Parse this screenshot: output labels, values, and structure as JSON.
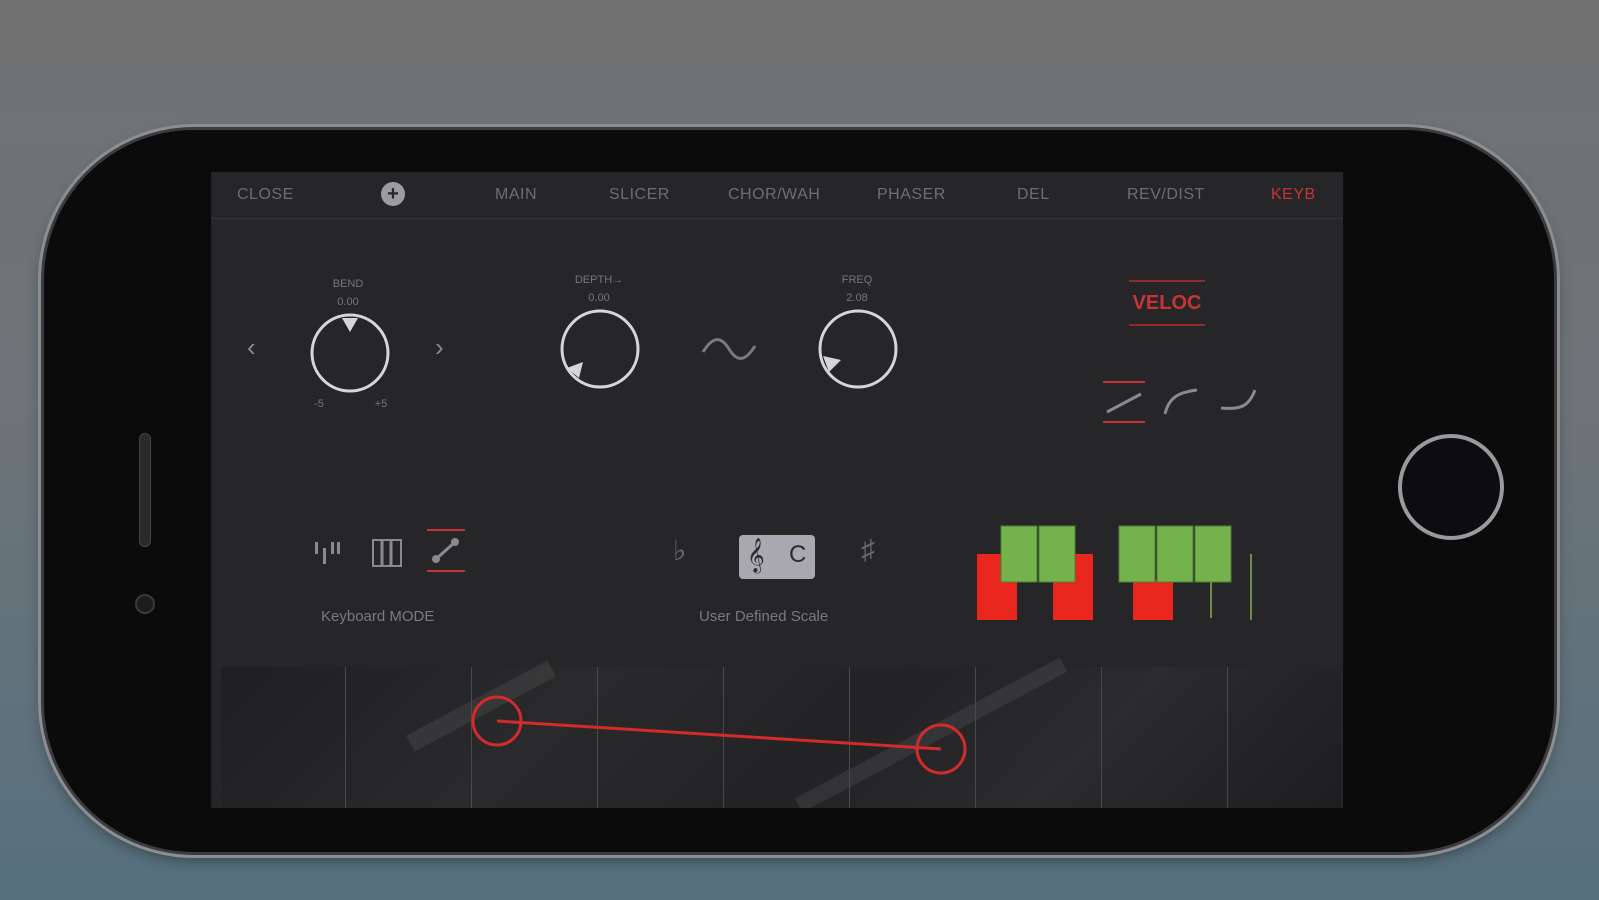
{
  "nav": {
    "close": "CLOSE",
    "plus": "+",
    "tabs": [
      "MAIN",
      "SLICER",
      "CHOR/WAH",
      "PHASER",
      "DEL",
      "REV/DIST",
      "KEYB"
    ],
    "active_tab": "KEYB"
  },
  "bend": {
    "label": "BEND",
    "value": "0.00",
    "min": "-5",
    "max": "+5",
    "prev": "‹",
    "next": "›"
  },
  "depth": {
    "label": "DEPTH→",
    "value": "0.00"
  },
  "freq": {
    "label": "FREQ",
    "value": "2.08"
  },
  "velocity": {
    "label": "VELOC"
  },
  "keyboard_mode": {
    "label": "Keyboard MODE",
    "selected": "glide"
  },
  "scale": {
    "label": "User Defined Scale",
    "flat": "♭",
    "key": "C",
    "sharp": "♯",
    "clef": "𝄞"
  },
  "colors": {
    "accent": "#c83436",
    "green": "#75b24c",
    "red": "#e8261e",
    "bg": "#262628"
  }
}
